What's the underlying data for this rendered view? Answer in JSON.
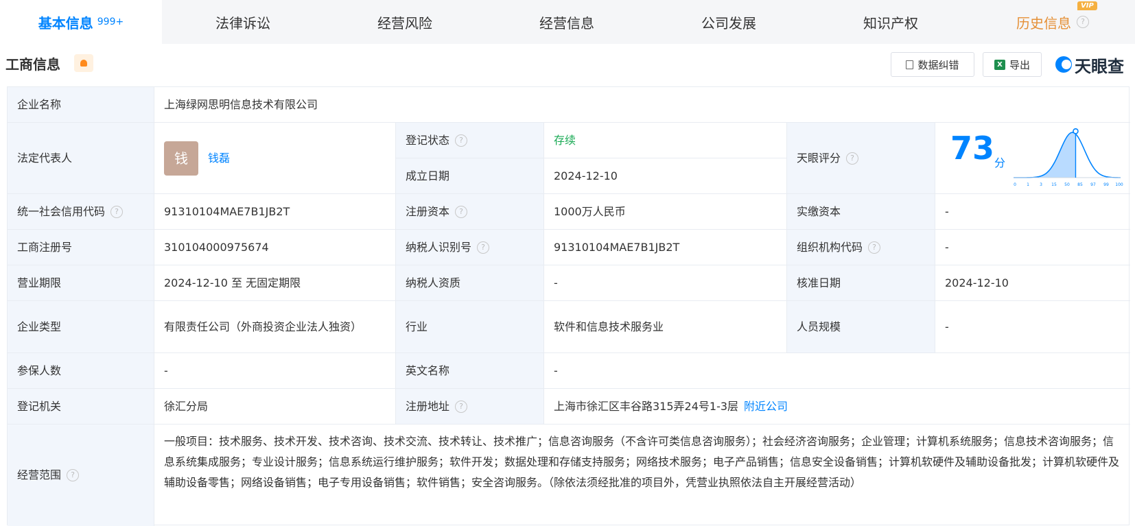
{
  "tabs": [
    {
      "label": "基本信息",
      "count": "999+",
      "active": true
    },
    {
      "label": "法律诉讼"
    },
    {
      "label": "经营风险"
    },
    {
      "label": "经营信息"
    },
    {
      "label": "公司发展"
    },
    {
      "label": "知识产权"
    },
    {
      "label": "历史信息",
      "badge": "VIP"
    }
  ],
  "header": {
    "title": "工商信息",
    "correct_button": "数据纠错",
    "export_button": "导出",
    "export_icon": "X",
    "logo": "天眼查"
  },
  "avatar_char": "钱",
  "help_glyph": "?",
  "fields": {
    "company_name": {
      "label": "企业名称",
      "value": "上海绿网思明信息技术有限公司"
    },
    "legal_rep": {
      "label": "法定代表人",
      "value": "钱磊"
    },
    "reg_status": {
      "label": "登记状态",
      "value": "存续"
    },
    "est_date": {
      "label": "成立日期",
      "value": "2024-12-10"
    },
    "tianyan_score": {
      "label": "天眼评分",
      "value": "73",
      "unit": "分"
    },
    "credit_code": {
      "label": "统一社会信用代码",
      "value": "91310104MAE7B1JB2T"
    },
    "reg_capital": {
      "label": "注册资本",
      "value": "1000万人民币"
    },
    "paid_capital": {
      "label": "实缴资本",
      "value": "-"
    },
    "reg_no": {
      "label": "工商注册号",
      "value": "310104000975674"
    },
    "taxpayer_id": {
      "label": "纳税人识别号",
      "value": "91310104MAE7B1JB2T"
    },
    "org_code": {
      "label": "组织机构代码",
      "value": "-"
    },
    "biz_term": {
      "label": "营业期限",
      "value": "2024-12-10 至 无固定期限"
    },
    "taxpayer_qual": {
      "label": "纳税人资质",
      "value": "-"
    },
    "approval_date": {
      "label": "核准日期",
      "value": "2024-12-10"
    },
    "company_type": {
      "label": "企业类型",
      "value": "有限责任公司（外商投资企业法人独资）"
    },
    "industry": {
      "label": "行业",
      "value": "软件和信息技术服务业"
    },
    "staff_size": {
      "label": "人员规模",
      "value": "-"
    },
    "insured": {
      "label": "参保人数",
      "value": "-"
    },
    "english_name": {
      "label": "英文名称",
      "value": "-"
    },
    "reg_authority": {
      "label": "登记机关",
      "value": "徐汇分局"
    },
    "reg_address": {
      "label": "注册地址",
      "value": "上海市徐汇区丰谷路315弄24号1-3层",
      "link": "附近公司"
    },
    "biz_scope": {
      "label": "经营范围",
      "value": "一般项目：技术服务、技术开发、技术咨询、技术交流、技术转让、技术推广；信息咨询服务（不含许可类信息咨询服务）；社会经济咨询服务；企业管理；计算机系统服务；信息技术咨询服务；信息系统集成服务；专业设计服务；信息系统运行维护服务；软件开发；数据处理和存储支持服务；网络技术服务；电子产品销售；信息安全设备销售；计算机软硬件及辅助设备批发；计算机软硬件及辅助设备零售；网络设备销售；电子专用设备销售；软件销售；安全咨询服务。（除依法须经批准的项目外，凭营业执照依法自主开展经营活动）"
    }
  },
  "score_chart": {
    "x_ticks": [
      "0",
      "1",
      "3",
      "15",
      "50",
      "85",
      "97",
      "99",
      "100"
    ],
    "marker_value": 73,
    "colors": {
      "accent": "#0084ff",
      "fill": "#b9dbff"
    }
  },
  "colors": {
    "accent": "#0084ff",
    "status_green": "#1aaa55",
    "label_bg": "#f2f6fc",
    "vip": "#e59037"
  }
}
